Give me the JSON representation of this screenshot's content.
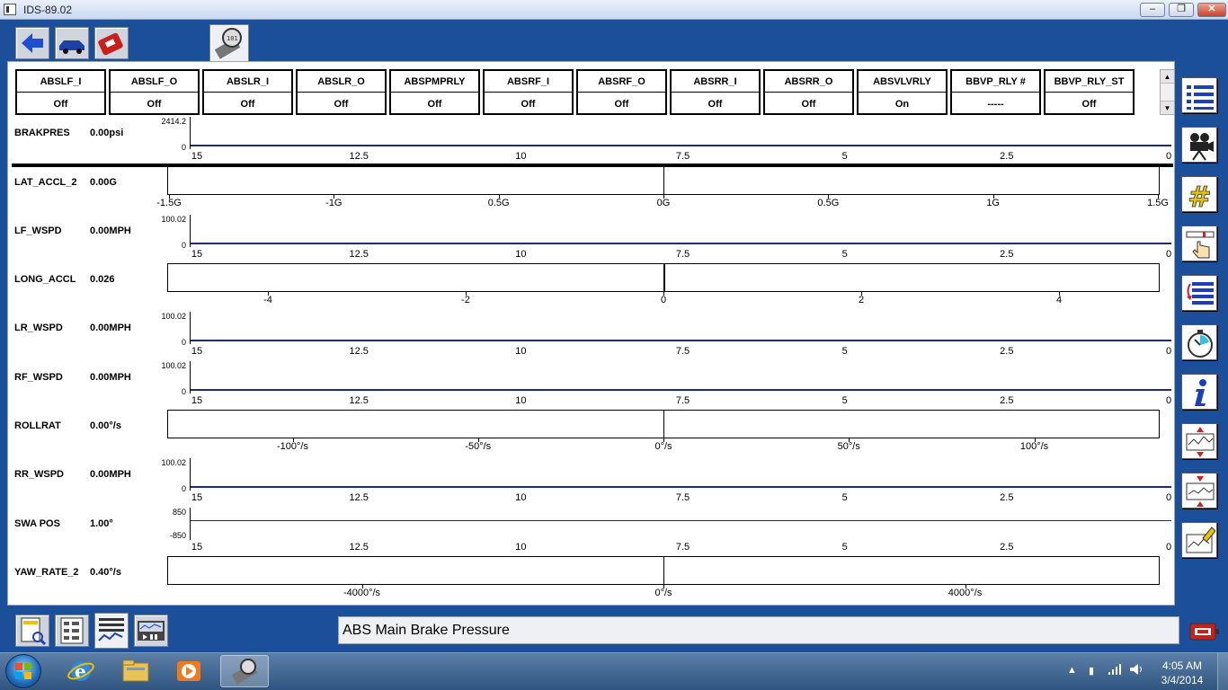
{
  "window": {
    "title": "IDS-89.02",
    "minimize": "–",
    "restore": "❐",
    "close": "✕"
  },
  "header_params": [
    {
      "name": "ABSLF_I",
      "value": "Off"
    },
    {
      "name": "ABSLF_O",
      "value": "Off"
    },
    {
      "name": "ABSLR_I",
      "value": "Off"
    },
    {
      "name": "ABSLR_O",
      "value": "Off"
    },
    {
      "name": "ABSPMPRLY",
      "value": "Off"
    },
    {
      "name": "ABSRF_I",
      "value": "Off"
    },
    {
      "name": "ABSRF_O",
      "value": "Off"
    },
    {
      "name": "ABSRR_I",
      "value": "Off"
    },
    {
      "name": "ABSRR_O",
      "value": "Off"
    },
    {
      "name": "ABSVLVRLY",
      "value": "On"
    },
    {
      "name": "BBVP_RLY #",
      "value": "-----"
    },
    {
      "name": "BBVP_RLY_ST",
      "value": "Off"
    }
  ],
  "scroll": {
    "up": "▲",
    "down": "▼"
  },
  "time_ticks": [
    "15",
    "12.5",
    "10",
    "7.5",
    "5",
    "2.5",
    "0"
  ],
  "signals": [
    {
      "id": "brakpres",
      "name": "BRAKPRES",
      "value": "0.00psi",
      "kind": "plot",
      "ymax": "2414.2",
      "ymin": "0"
    },
    {
      "id": "lat",
      "name": "LAT_ACCL_2",
      "value": "0.00G",
      "kind": "gauge",
      "ticks": [
        "-1.5G",
        "-1G",
        "0.5G",
        "0G",
        "0.5G",
        "1G",
        "1.5G"
      ],
      "level": 0.0
    },
    {
      "id": "lfw",
      "name": "LF_WSPD",
      "value": "0.00MPH",
      "kind": "plot",
      "ymax": "100.02",
      "ymin": "0"
    },
    {
      "id": "long",
      "name": "LONG_ACCL",
      "value": "0.026",
      "kind": "gauge",
      "ticks": [
        "-4",
        "-2",
        "0",
        "2",
        "4"
      ],
      "level": 0.026
    },
    {
      "id": "lrw",
      "name": "LR_WSPD",
      "value": "0.00MPH",
      "kind": "plot",
      "ymax": "100.02",
      "ymin": "0"
    },
    {
      "id": "rfw",
      "name": "RF_WSPD",
      "value": "0.00MPH",
      "kind": "plot",
      "ymax": "100.02",
      "ymin": "0"
    },
    {
      "id": "roll",
      "name": "ROLLRAT",
      "value": "0.00°/s",
      "kind": "gauge",
      "ticks": [
        "-100°/s",
        "-50°/s",
        "0°/s",
        "50°/s",
        "100°/s"
      ],
      "level": 0.0
    },
    {
      "id": "rrw",
      "name": "RR_WSPD",
      "value": "0.00MPH",
      "kind": "plot",
      "ymax": "100.02",
      "ymin": "0"
    },
    {
      "id": "swa",
      "name": "SWA POS",
      "value": "1.00°",
      "kind": "plot",
      "ymax": "850",
      "ymin": "-850"
    },
    {
      "id": "yaw",
      "name": "YAW_RATE_2",
      "value": "0.40°/s",
      "kind": "gauge",
      "ticks": [
        "-4000°/s",
        "0°/s",
        "4000°/s"
      ],
      "level": 0.4
    }
  ],
  "status": {
    "text": "ABS Main Brake Pressure"
  },
  "clock": {
    "time": "4:05 AM",
    "date": "3/4/2014"
  },
  "colors": {
    "frame": "#1c4f9a",
    "trace": "#1b2b78"
  }
}
